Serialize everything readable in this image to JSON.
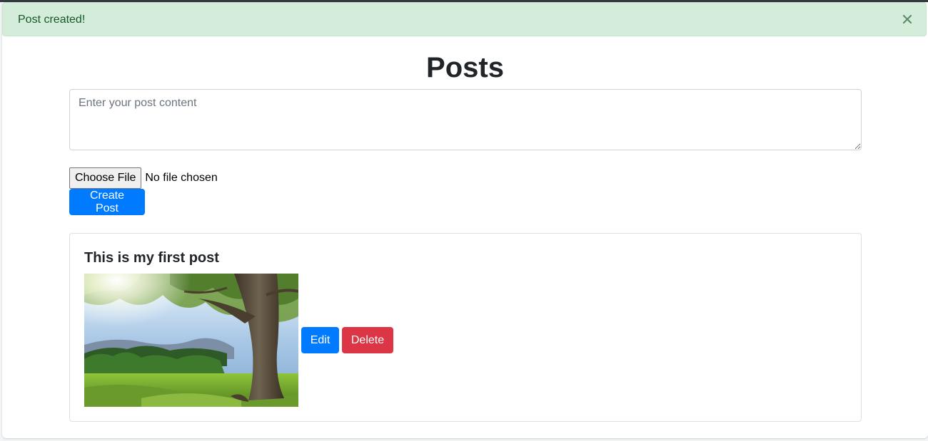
{
  "alert": {
    "message": "Post created!",
    "close_icon": "close-icon",
    "colors": {
      "background": "#d4edda",
      "text": "#155724"
    }
  },
  "page": {
    "title": "Posts"
  },
  "form": {
    "content_placeholder": "Enter your post content",
    "content_value": "",
    "file_button_label": "Choose File",
    "file_status": "No file chosen",
    "submit_label": "Create Post"
  },
  "posts": [
    {
      "content": "This is my first post",
      "image": "tree-meadow-photo",
      "edit_label": "Edit",
      "delete_label": "Delete"
    }
  ],
  "colors": {
    "primary": "#007bff",
    "danger": "#dc3545"
  }
}
